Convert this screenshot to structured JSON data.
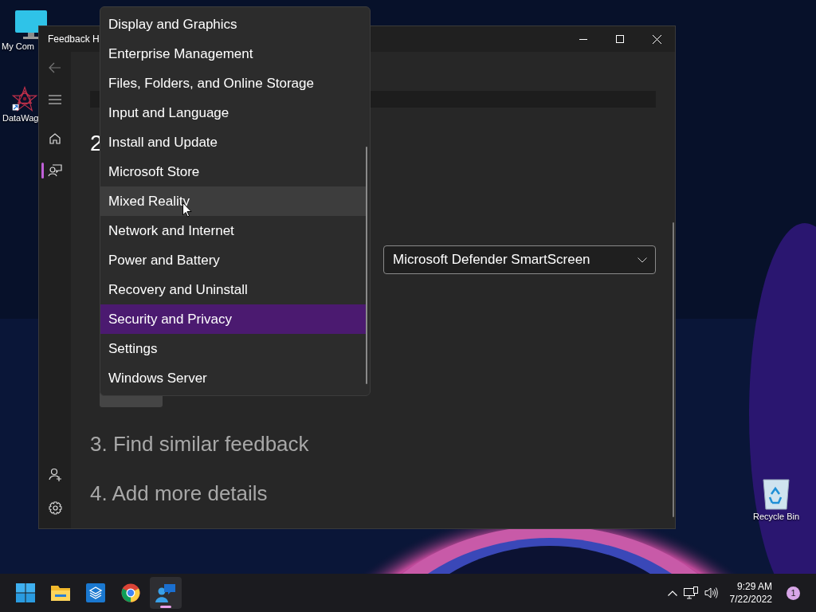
{
  "desktop": {
    "icons": [
      {
        "kind": "computer",
        "label": "My Com"
      },
      {
        "kind": "app",
        "label": "DataWag"
      },
      {
        "kind": "recycle-bin",
        "label": "Recycle Bin"
      }
    ]
  },
  "window": {
    "title": "Feedback H",
    "sidebar": {
      "items": [
        {
          "kind": "home",
          "selected": false
        },
        {
          "kind": "feedback",
          "selected": true
        }
      ]
    },
    "step_heading": "2",
    "category_dropdown": {
      "value": "Microsoft Defender SmartScreen"
    },
    "steps": [
      "3. Find similar feedback",
      "4. Add more details"
    ]
  },
  "menu": {
    "items": [
      {
        "label": "Display and Graphics",
        "selected": false,
        "hovered": false
      },
      {
        "label": "Enterprise Management",
        "selected": false,
        "hovered": false
      },
      {
        "label": "Files, Folders, and Online Storage",
        "selected": false,
        "hovered": false
      },
      {
        "label": "Input and Language",
        "selected": false,
        "hovered": false
      },
      {
        "label": "Install and Update",
        "selected": false,
        "hovered": false
      },
      {
        "label": "Microsoft Store",
        "selected": false,
        "hovered": false
      },
      {
        "label": "Mixed Reality",
        "selected": false,
        "hovered": true
      },
      {
        "label": "Network and Internet",
        "selected": false,
        "hovered": false
      },
      {
        "label": "Power and Battery",
        "selected": false,
        "hovered": false
      },
      {
        "label": "Recovery and Uninstall",
        "selected": false,
        "hovered": false
      },
      {
        "label": "Security and Privacy",
        "selected": true,
        "hovered": false
      },
      {
        "label": "Settings",
        "selected": false,
        "hovered": false
      },
      {
        "label": "Windows Server",
        "selected": false,
        "hovered": false
      }
    ]
  },
  "taskbar": {
    "apps": [
      {
        "kind": "start",
        "active": false
      },
      {
        "kind": "explorer",
        "active": false
      },
      {
        "kind": "box",
        "active": false
      },
      {
        "kind": "browser",
        "active": false
      },
      {
        "kind": "feedback",
        "active": true
      }
    ],
    "time": "9:29 AM",
    "date": "7/22/2022",
    "notification_count": "1"
  }
}
